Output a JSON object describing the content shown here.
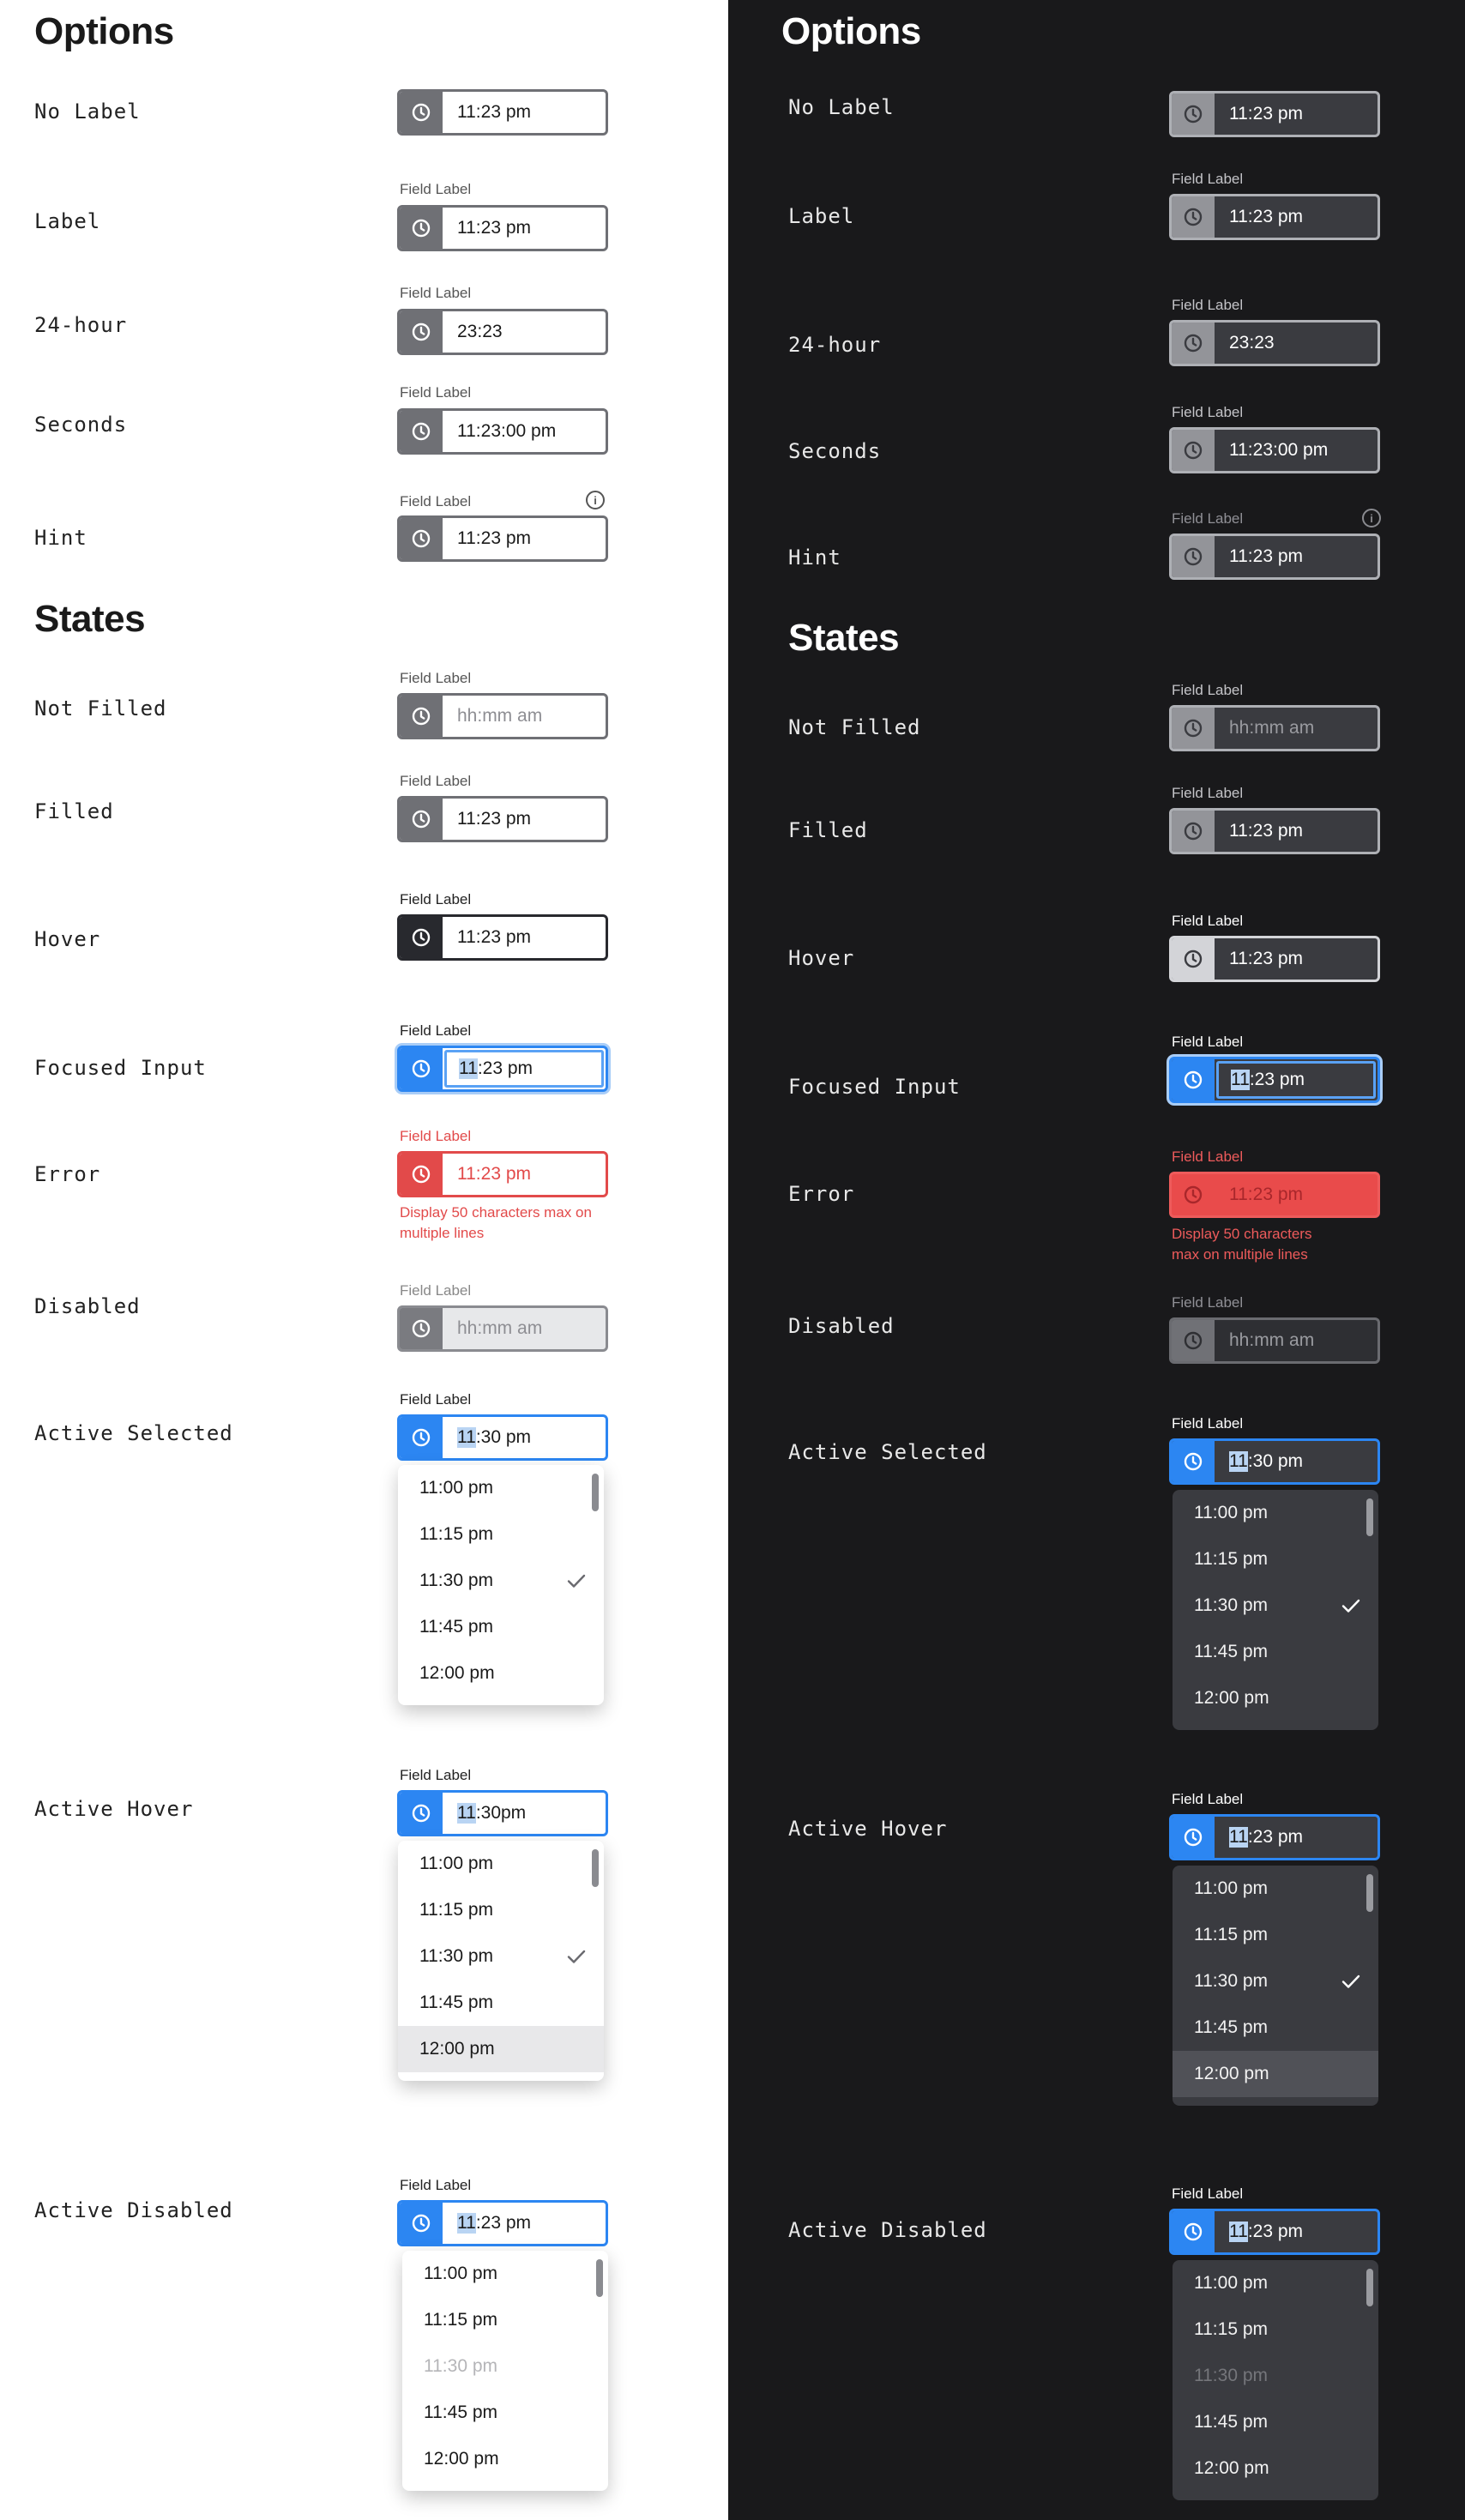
{
  "icons": {
    "clock": "clock-icon",
    "check": "check-icon",
    "info": "info-icon"
  },
  "colors": {
    "light_background": "#ffffff",
    "dark_background": "#19191b",
    "accent_blue": "#2c86f2",
    "error_red": "#e24a4a",
    "icon_box_gray": "#6f7075",
    "hover_dark": "#28292e"
  },
  "sections": {
    "options": "Options",
    "states": "States"
  },
  "labels": {
    "no_label": "No Label",
    "label": "Label",
    "h24": "24-hour",
    "seconds": "Seconds",
    "hint": "Hint",
    "not_filled": "Not Filled",
    "filled": "Filled",
    "hover": "Hover",
    "focused_input": "Focused Input",
    "error": "Error",
    "disabled": "Disabled",
    "active_selected": "Active Selected",
    "active_hover": "Active Hover",
    "active_disabled": "Active Disabled"
  },
  "field_label": "Field Label",
  "values": {
    "time": "11:23 pm",
    "time_24": "23:23",
    "time_seconds": "11:23:00 pm",
    "placeholder": "hh:mm am",
    "hour_selected": "11",
    "focused_rest": ":23 pm",
    "active_selected_rest": ":30 pm",
    "active_hover_rest_light": ":30pm",
    "active_hover_rest_dark": ":23 pm",
    "active_disabled_rest": ":23 pm"
  },
  "error_message": {
    "light": "Display 50 characters max on multiple lines",
    "dark": "Display 50 characters max on multiple lines"
  },
  "options": [
    "11:00 pm",
    "11:15 pm",
    "11:30 pm",
    "11:45 pm",
    "12:00 pm"
  ],
  "selected_option": "11:30 pm",
  "hovered_option": "12:00 pm",
  "disabled_option": "11:30 pm"
}
